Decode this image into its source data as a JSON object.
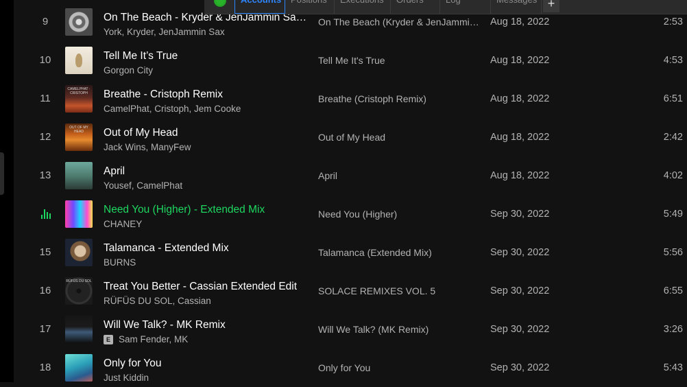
{
  "overlay": {
    "tabs": [
      "Accounts",
      "Positions",
      "Executions",
      "Orders",
      "Log",
      "Messages"
    ],
    "active_tab": "Accounts",
    "add_label": "+",
    "colors": {
      "status": "#28b32a",
      "active_tab": "#2e86ff"
    }
  },
  "tracks": [
    {
      "num": "9",
      "title": "On The Beach - Kryder & JenJammin Sax Remix",
      "artist": "York, Kryder, JenJammin Sax",
      "explicit": false,
      "album": "On The Beach (Kryder & JenJammin Sax Remix)",
      "date": "Aug 18, 2022",
      "duration": "2:53",
      "playing": false
    },
    {
      "num": "10",
      "title": "Tell Me It’s True",
      "artist": "Gorgon City",
      "explicit": false,
      "album": "Tell Me It's True",
      "date": "Aug 18, 2022",
      "duration": "4:53",
      "playing": false
    },
    {
      "num": "11",
      "title": "Breathe - Cristoph Remix",
      "artist": "CamelPhat, Cristoph, Jem Cooke",
      "explicit": false,
      "album": "Breathe (Cristoph Remix)",
      "date": "Aug 18, 2022",
      "duration": "6:51",
      "playing": false
    },
    {
      "num": "12",
      "title": "Out of My Head",
      "artist": "Jack Wins, ManyFew",
      "explicit": false,
      "album": "Out of My Head",
      "date": "Aug 18, 2022",
      "duration": "2:42",
      "playing": false
    },
    {
      "num": "13",
      "title": "April",
      "artist": "Yousef, CamelPhat",
      "explicit": false,
      "album": "April",
      "date": "Aug 18, 2022",
      "duration": "4:02",
      "playing": false
    },
    {
      "num": "14",
      "title": "Need You (Higher) - Extended Mix",
      "artist": "CHANEY",
      "explicit": false,
      "album": "Need You (Higher)",
      "date": "Sep 30, 2022",
      "duration": "5:49",
      "playing": true
    },
    {
      "num": "15",
      "title": "Talamanca - Extended Mix",
      "artist": "BURNS",
      "explicit": false,
      "album": "Talamanca (Extended Mix)",
      "date": "Sep 30, 2022",
      "duration": "5:56",
      "playing": false
    },
    {
      "num": "16",
      "title": "Treat You Better - Cassian Extended Edit",
      "artist": "RÜFÜS DU SOL, Cassian",
      "explicit": false,
      "album": "SOLACE REMIXES VOL. 5",
      "date": "Sep 30, 2022",
      "duration": "6:55",
      "playing": false
    },
    {
      "num": "17",
      "title": "Will We Talk? - MK Remix",
      "artist": "Sam Fender, MK",
      "explicit": true,
      "album": "Will We Talk? (MK Remix)",
      "date": "Sep 30, 2022",
      "duration": "3:26",
      "playing": false
    },
    {
      "num": "18",
      "title": "Only for You",
      "artist": "Just Kiddin",
      "explicit": false,
      "album": "Only for You",
      "date": "Sep 30, 2022",
      "duration": "5:43",
      "playing": false
    }
  ],
  "explicit_label": "E",
  "cover_labels": {
    "11": "CAMELPHAT · CRISTOPH",
    "12": "OUT OF MY HEAD",
    "16": "RÜFÜS DU SOL"
  },
  "colors": {
    "background": "#121212",
    "text": "#b3b3b3",
    "title": "#ffffff",
    "accent": "#1ed760"
  }
}
